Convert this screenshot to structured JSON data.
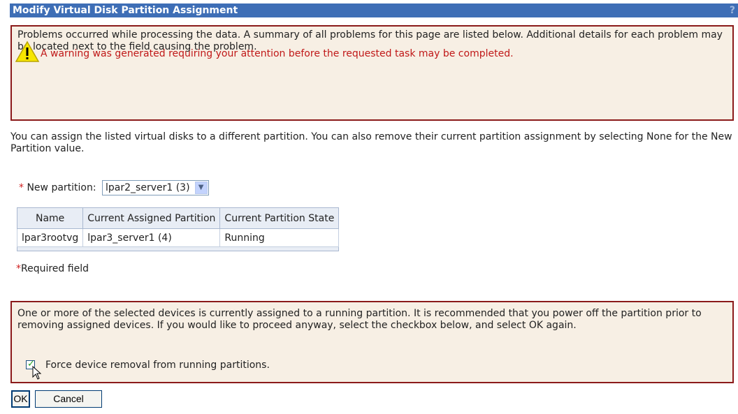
{
  "titlebar": {
    "title": "Modify Virtual Disk Partition Assignment",
    "help_glyph": "?"
  },
  "error_box": {
    "message": "Problems occurred while processing the data. A summary of all problems for this page are listed below. Additional details for each problem may be located next to the field causing the problem.",
    "warning_icon": "warning-triangle-icon",
    "warning_text": "A warning was generated requiring your attention before the requested task may be completed."
  },
  "intro_text": "You can assign the listed virtual disks to a different partition. You can also remove their current partition assignment by selecting None for the New Partition value.",
  "new_partition": {
    "required_marker": "*",
    "label": "New partition:",
    "selected_value": "lpar2_server1 (3)"
  },
  "table": {
    "headers": [
      "Name",
      "Current Assigned Partition",
      "Current Partition State"
    ],
    "rows": [
      [
        "lpar3rootvg",
        "lpar3_server1 (4)",
        "Running"
      ]
    ]
  },
  "required_note": {
    "marker": "*",
    "text": "Required field"
  },
  "warning_box": {
    "message": "One or more of the selected devices is currently assigned to a running partition. It is recommended that you power off the partition prior to removing assigned devices. If you would like to proceed anyway, select the checkbox below, and select OK again.",
    "force_checkbox_label": "Force device removal from running partitions.",
    "force_checked": true
  },
  "buttons": {
    "ok_label": "OK",
    "cancel_label": "Cancel"
  },
  "colors": {
    "titlebar": "#3e6eb6",
    "error_border": "#8b1a1a",
    "error_bg": "#f7efe4",
    "warning_text": "#c01818"
  }
}
